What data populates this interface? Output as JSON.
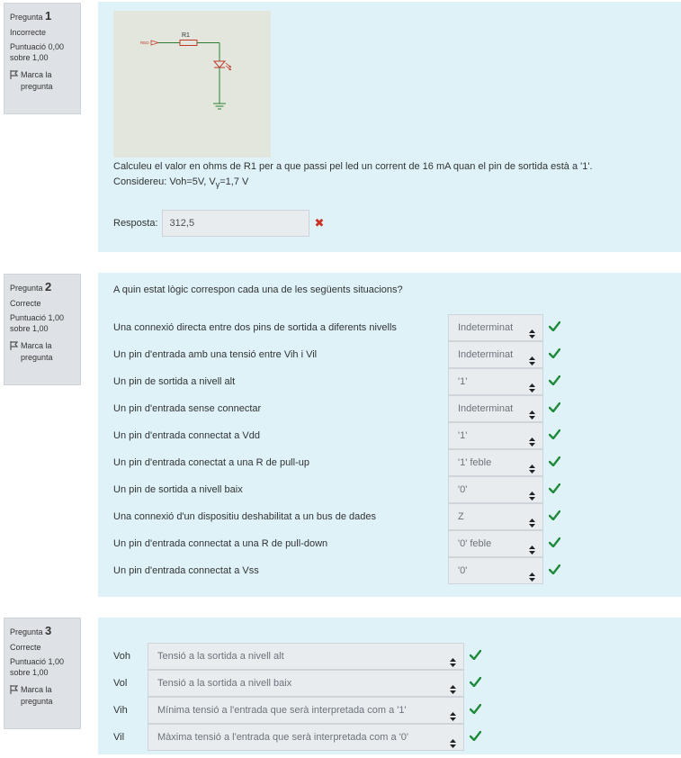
{
  "questions": [
    {
      "prefix": "Pregunta",
      "number": "1",
      "state": "Incorrecte",
      "grade_line1": "Puntuació 0,00",
      "grade_line2": "sobre 1,00",
      "flag_line1": "Marca la",
      "flag_line2": "pregunta"
    },
    {
      "prefix": "Pregunta",
      "number": "2",
      "state": "Correcte",
      "grade_line1": "Puntuació 1,00",
      "grade_line2": "sobre 1,00",
      "flag_line1": "Marca la",
      "flag_line2": "pregunta"
    },
    {
      "prefix": "Pregunta",
      "number": "3",
      "state": "Correcte",
      "grade_line1": "Puntuació 1,00",
      "grade_line2": "sobre 1,00",
      "flag_line1": "Marca la",
      "flag_line2": "pregunta"
    }
  ],
  "q1": {
    "circuit_label_red": "RED",
    "circuit_label_r1": "R1",
    "text_line1": "Calculeu el valor en ohms de R1 per a que passi pel led un corrent de 16 mA quan el pin de sortida està a '1'.",
    "text_line2_prefix": "Considereu: Voh=5V, V",
    "text_line2_sub": "γ",
    "text_line2_suffix": "=1,7 V",
    "answer_label": "Resposta:",
    "answer_value": "312,5"
  },
  "q2": {
    "prompt": "A quin estat lògic correspon cada una de les següents situacions?",
    "rows": [
      {
        "label": "Una connexió directa entre dos pins de sortida a diferents nivells",
        "value": "Indeterminat"
      },
      {
        "label": "Un pin d'entrada amb una tensió entre Vih i Vil",
        "value": "Indeterminat"
      },
      {
        "label": "Un pin de sortida a nivell alt",
        "value": "'1'"
      },
      {
        "label": "Un pin d'entrada sense connectar",
        "value": "Indeterminat"
      },
      {
        "label": "Un pin d'entrada connectat a Vdd",
        "value": "'1'"
      },
      {
        "label": "Un pin d'entrada conectat a una R de pull-up",
        "value": "'1' feble"
      },
      {
        "label": "Un pin de sortida a nivell baix",
        "value": "'0'"
      },
      {
        "label": "Una connexió d'un dispositiu deshabilitat a un bus de dades",
        "value": "Z"
      },
      {
        "label": "Un pin d'entrada connectat a una R de pull-down",
        "value": "'0' feble"
      },
      {
        "label": "Un pin d'entrada connectat a Vss",
        "value": "'0'"
      }
    ]
  },
  "q3": {
    "rows": [
      {
        "label": "Voh",
        "value": "Tensió a la sortida a nivell alt"
      },
      {
        "label": "Vol",
        "value": "Tensió a la sortida a nivell baix"
      },
      {
        "label": "Vih",
        "value": "Mínima tensió a l'entrada que serà interpretada com a '1'"
      },
      {
        "label": "Vil",
        "value": "Màxima tensió a l'entrada que serà interpretada com a '0'"
      }
    ]
  },
  "colors": {
    "correct": "#1f8a3a",
    "incorrect": "#ca3120",
    "panel": "#def2f8",
    "info": "#dee2e6"
  }
}
